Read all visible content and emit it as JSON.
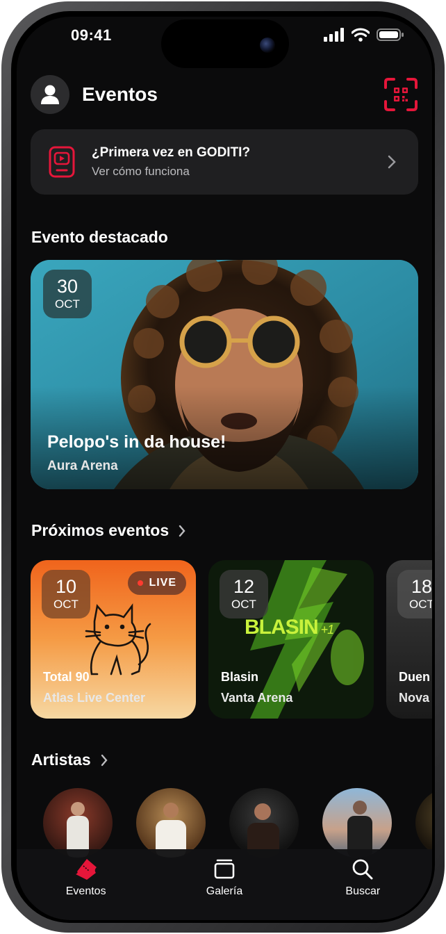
{
  "status_bar": {
    "time": "09:41"
  },
  "header": {
    "title": "Eventos"
  },
  "promo": {
    "title": "¿Primera vez en GODITI?",
    "subtitle": "Ver cómo funciona"
  },
  "featured": {
    "section_title": "Evento destacado",
    "event": {
      "day": "30",
      "month": "OCT",
      "title": "Pelopo's in da house!",
      "venue": "Aura Arena"
    }
  },
  "upcoming": {
    "section_title": "Próximos eventos",
    "events": [
      {
        "day": "10",
        "month": "OCT",
        "title": "Total 90",
        "venue": "Atlas Live Center",
        "badge": "LIVE"
      },
      {
        "day": "12",
        "month": "OCT",
        "title": "Blasin",
        "venue": "Vanta Arena",
        "art_text": "BLASIN",
        "art_signature": "+1"
      },
      {
        "day": "18",
        "month": "OCT",
        "title": "Duen",
        "venue": "Nova"
      }
    ]
  },
  "artists": {
    "section_title": "Artistas"
  },
  "tabbar": {
    "items": [
      {
        "label": "Eventos",
        "icon": "ticket-icon",
        "active": true
      },
      {
        "label": "Galería",
        "icon": "gallery-icon",
        "active": false
      },
      {
        "label": "Buscar",
        "icon": "search-icon",
        "active": false
      }
    ]
  },
  "colors": {
    "accent": "#e5163a",
    "background": "#0b0b0c",
    "card": "#1f1f21"
  }
}
